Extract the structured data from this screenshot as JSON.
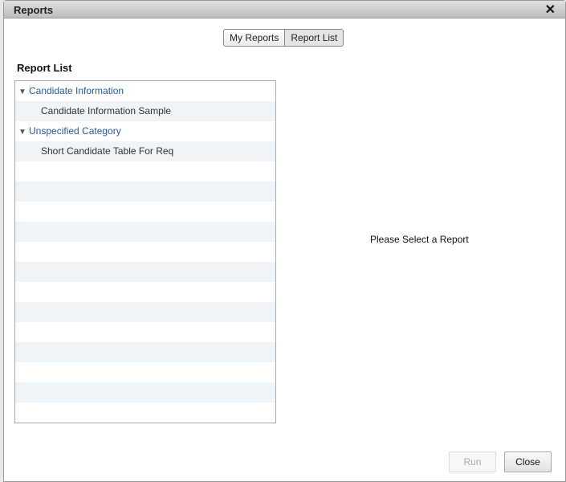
{
  "dialog": {
    "title": "Reports",
    "close_icon": "✖"
  },
  "toggle": {
    "my_reports": "My Reports",
    "report_list": "Report List",
    "active": "report_list"
  },
  "heading": "Report List",
  "tree": [
    {
      "label": "Candidate Information",
      "items": [
        "Candidate Information Sample"
      ]
    },
    {
      "label": "Unspecified Category",
      "items": [
        "Short Candidate Table For Req"
      ]
    }
  ],
  "placeholder": "Please Select a Report",
  "buttons": {
    "run": "Run",
    "close": "Close"
  }
}
